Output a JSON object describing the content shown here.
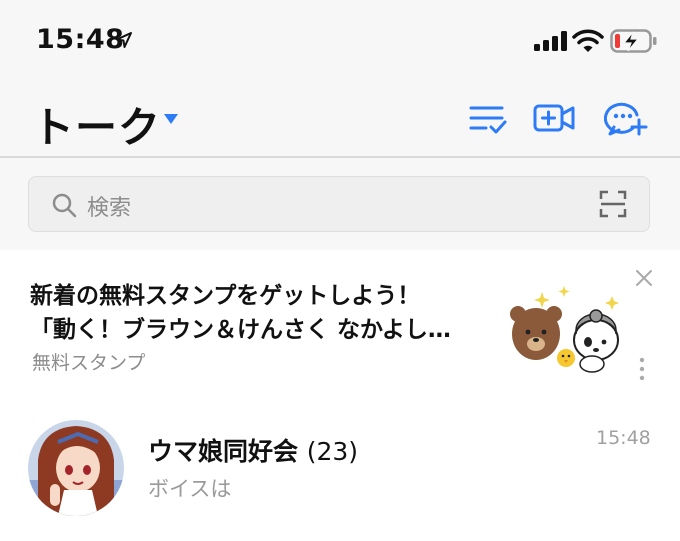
{
  "status_bar": {
    "time": "15:48"
  },
  "header": {
    "title": "トーク"
  },
  "search": {
    "placeholder": "検索"
  },
  "promo": {
    "line1": "新着の無料スタンプをゲットしよう！",
    "line2": "「動く！ブラウン＆けんさく なかよし…",
    "subtitle": "無料スタンプ"
  },
  "chats": [
    {
      "name": "ウマ娘同好会",
      "count": "(23)",
      "message": "ボイスは",
      "time": "15:48"
    }
  ],
  "colors": {
    "accent": "#2e7bf6",
    "battery_low": "#ef3b36"
  },
  "icons": [
    "location-arrow-icon",
    "signal-icon",
    "wifi-icon",
    "battery-charging-icon",
    "chevron-down-icon",
    "sort-check-icon",
    "video-add-icon",
    "chat-add-icon",
    "search-icon",
    "scan-icon",
    "close-icon",
    "more-vertical-icon"
  ]
}
